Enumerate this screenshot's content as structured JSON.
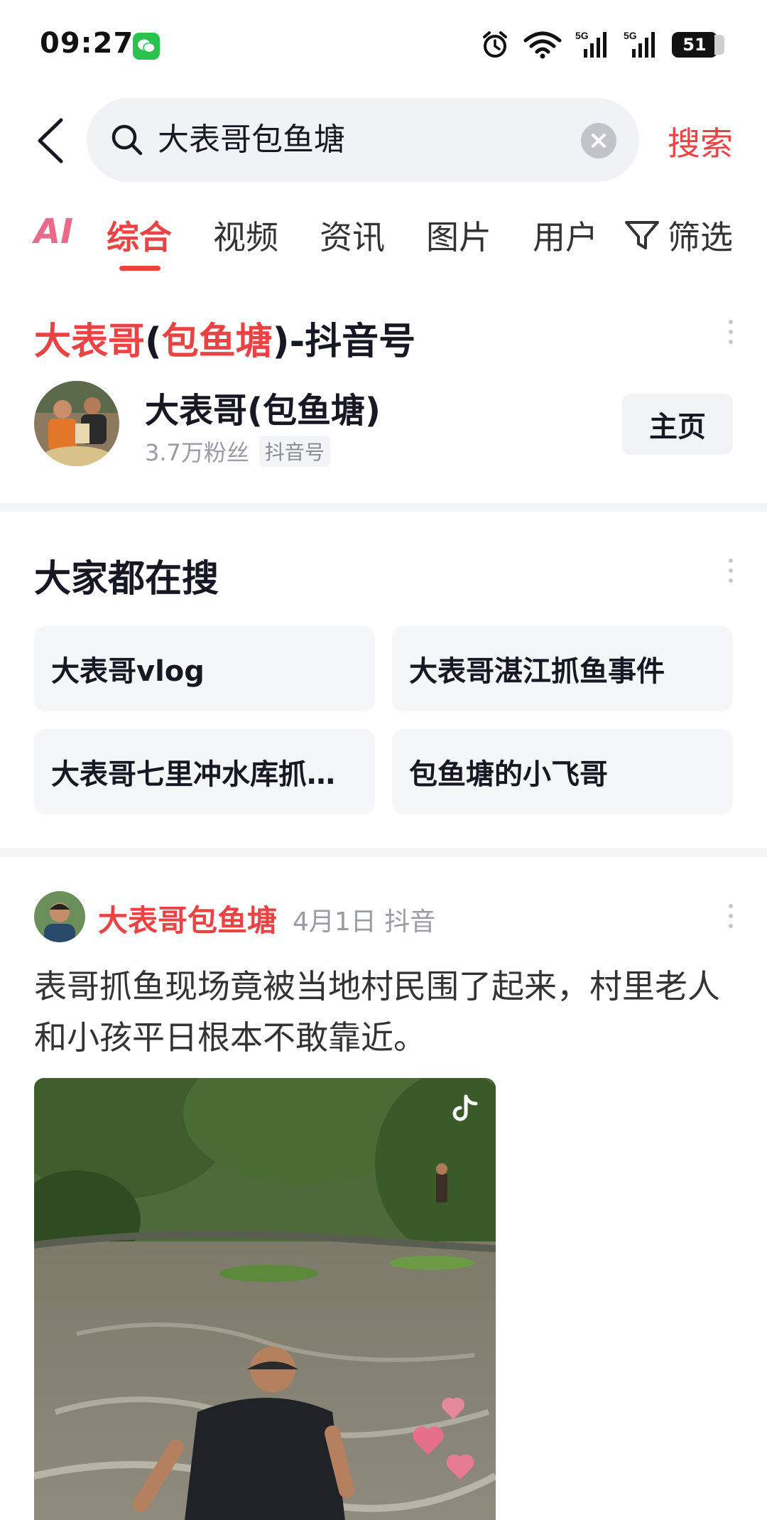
{
  "status_bar": {
    "time": "09:27",
    "battery_level": "51",
    "network": "5G"
  },
  "search": {
    "back_label": "back",
    "query": "大表哥包鱼塘",
    "submit_label": "搜索"
  },
  "tabs": {
    "ai": "AI",
    "items": [
      "综合",
      "视频",
      "资讯",
      "图片",
      "用户"
    ],
    "active": "综合",
    "filter_label": "筛选"
  },
  "account_card": {
    "title_prefix": "大表哥",
    "title_paren_open": "(",
    "title_highlight": "包鱼塘",
    "title_suffix": ")-抖音号",
    "name": "大表哥(包鱼塘)",
    "followers": "3.7万粉丝",
    "type_badge": "抖音号",
    "home_button": "主页"
  },
  "everyone_searching": {
    "title": "大家都在搜",
    "items": [
      "大表哥vlog",
      "大表哥湛江抓鱼事件",
      "大表哥七里冲水库抓…",
      "包鱼塘的小飞哥"
    ]
  },
  "post": {
    "author": "大表哥包鱼塘",
    "date": "4月1日",
    "source": "抖音",
    "text": "表哥抓鱼现场竟被当地村民围了起来，村里老人和小孩平日根本不敢靠近。"
  },
  "colors": {
    "accent": "#ea4343",
    "chip_bg": "#f5f6f8",
    "search_bg": "#f1f2f5",
    "wechat": "#2ac14f"
  }
}
